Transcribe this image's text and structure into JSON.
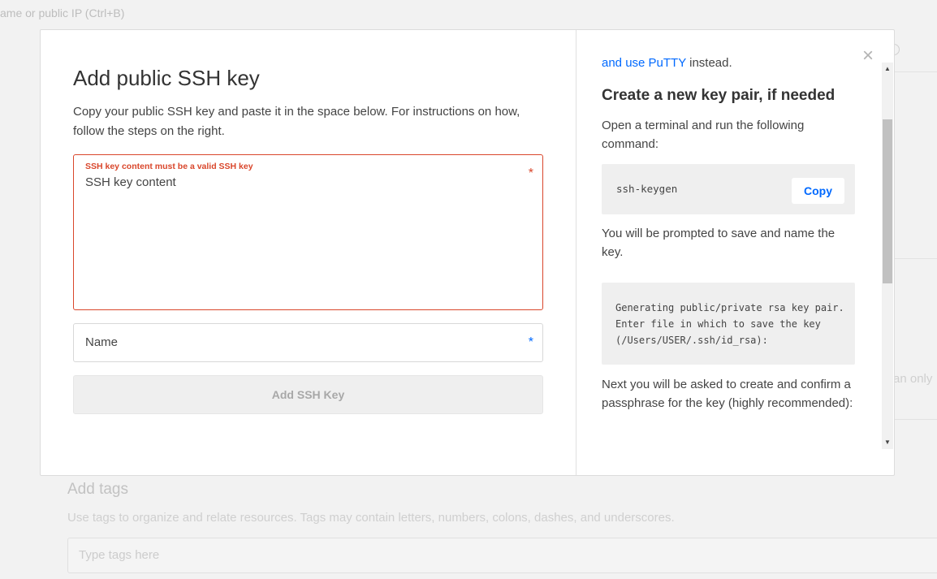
{
  "background": {
    "search_placeholder": "ame or public IP (Ctrl+B)",
    "right_fragment": "an only",
    "tags_title": "Add tags",
    "tags_desc": "Use tags to organize and relate resources. Tags may contain letters, numbers, colons, dashes, and underscores.",
    "tags_placeholder": "Type tags here"
  },
  "modal": {
    "title": "Add public SSH key",
    "description": "Copy your public SSH key and paste it in the space below. For instructions on how, follow the steps on the right.",
    "key_field": {
      "error": "SSH key content must be a valid SSH key",
      "label": "SSH key content",
      "required_mark": "*"
    },
    "name_field": {
      "label": "Name",
      "required_mark": "*"
    },
    "submit_label": "Add SSH Key",
    "close_icon": "close-icon"
  },
  "instructions": {
    "fragment_link": "and use PuTTY",
    "fragment_rest": " instead.",
    "heading": "Create a new key pair, if needed",
    "step1": "Open a terminal and run the following command:",
    "command1": "ssh-keygen",
    "copy_label": "Copy",
    "step2": "You will be prompted to save and name the key.",
    "output": "Generating public/private rsa key pair. Enter file in which to save the key (/Users/USER/.ssh/id_rsa):",
    "step3": "Next you will be asked to create and confirm a passphrase for the key (highly recommended):"
  },
  "colors": {
    "error": "#d9462b",
    "accent": "#0069ff"
  }
}
